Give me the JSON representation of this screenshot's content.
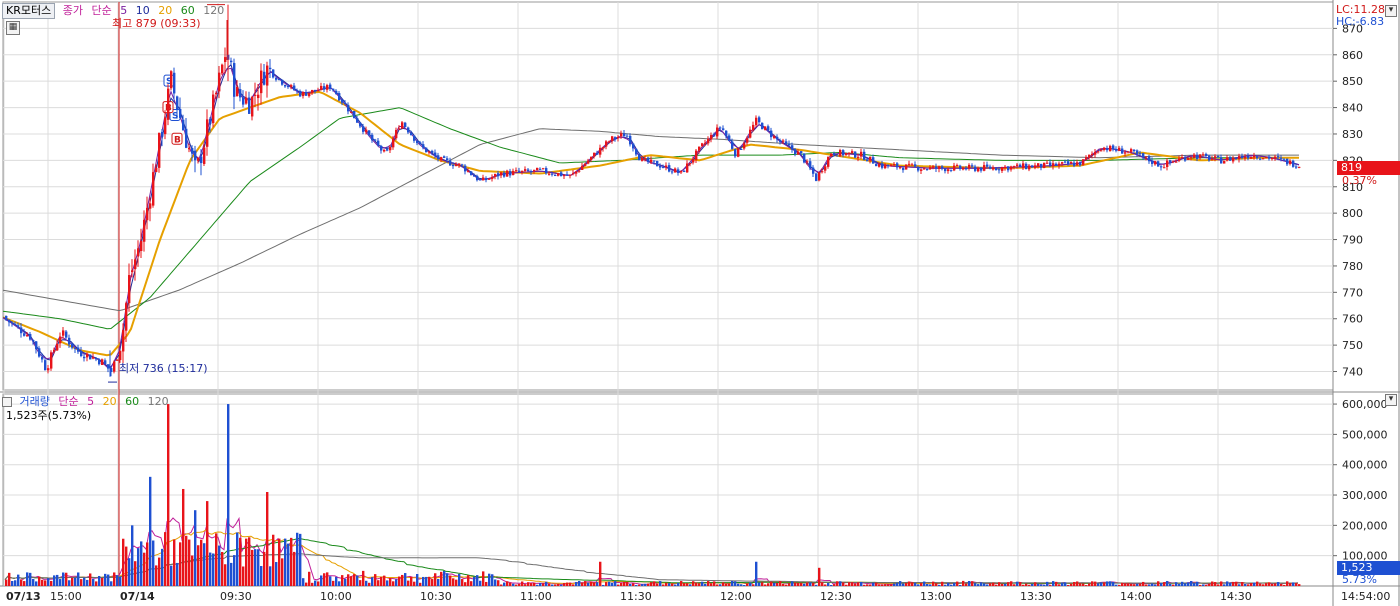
{
  "title": "KR모터스",
  "price_indicator": {
    "name": "종가",
    "method": "단순",
    "periods": [
      "5",
      "10",
      "20",
      "60",
      "120"
    ]
  },
  "volume_indicator": {
    "name": "거래량",
    "method": "단순",
    "periods": [
      "5",
      "20",
      "60",
      "120"
    ]
  },
  "volume_current": "1,523주(5.73%)",
  "annotations": {
    "high": "최고 879 (09:33)",
    "low": "최저 736 (15:17)"
  },
  "right_labels": {
    "lc": "LC:11.28",
    "hc": "HC:-6.83",
    "price_tag": "819",
    "price_pct": "0.37%",
    "vol_tag": "1,523",
    "vol_pct": "5.73%"
  },
  "price_axis": [
    "870",
    "860",
    "850",
    "840",
    "830",
    "820",
    "810",
    "800",
    "790",
    "780",
    "770",
    "760",
    "750",
    "740"
  ],
  "volume_axis": [
    "600,000",
    "500,000",
    "400,000",
    "300,000",
    "200,000",
    "100,000"
  ],
  "time_axis": [
    "07/13",
    "15:00",
    "07/14",
    "09:30",
    "10:00",
    "10:30",
    "11:00",
    "11:30",
    "12:00",
    "12:30",
    "13:00",
    "13:30",
    "14:00",
    "14:30",
    "14:54:00"
  ],
  "colors": {
    "up": "#e8141a",
    "down": "#1e50d2",
    "ma5": "#7a1fa0",
    "ma10": "#1e2c9c",
    "ma20": "#e6a000",
    "ma60": "#1a8a1a",
    "ma120": "#6e6e6e",
    "grid": "#dcdcdc"
  },
  "chart_data": {
    "type": "candlestick",
    "y_range": [
      733,
      880
    ],
    "volume_range": [
      0,
      620000
    ],
    "price_keypoints": [
      [
        0,
        761
      ],
      [
        30,
        753
      ],
      [
        45,
        741
      ],
      [
        60,
        755
      ],
      [
        75,
        748
      ],
      [
        100,
        744
      ],
      [
        110,
        740
      ],
      [
        120,
        750
      ],
      [
        128,
        775
      ],
      [
        140,
        790
      ],
      [
        150,
        810
      ],
      [
        160,
        830
      ],
      [
        170,
        850
      ],
      [
        180,
        835
      ],
      [
        195,
        815
      ],
      [
        205,
        830
      ],
      [
        215,
        845
      ],
      [
        225,
        862
      ],
      [
        235,
        845
      ],
      [
        250,
        842
      ],
      [
        265,
        855
      ],
      [
        280,
        850
      ],
      [
        300,
        845
      ],
      [
        330,
        848
      ],
      [
        350,
        838
      ],
      [
        370,
        828
      ],
      [
        385,
        822
      ],
      [
        400,
        835
      ],
      [
        420,
        825
      ],
      [
        440,
        820
      ],
      [
        460,
        818
      ],
      [
        480,
        812
      ],
      [
        500,
        815
      ],
      [
        540,
        816
      ],
      [
        570,
        814
      ],
      [
        590,
        821
      ],
      [
        610,
        828
      ],
      [
        625,
        830
      ],
      [
        640,
        820
      ],
      [
        660,
        818
      ],
      [
        680,
        815
      ],
      [
        700,
        825
      ],
      [
        720,
        833
      ],
      [
        735,
        822
      ],
      [
        755,
        835
      ],
      [
        775,
        828
      ],
      [
        800,
        822
      ],
      [
        815,
        813
      ],
      [
        830,
        823
      ],
      [
        860,
        822
      ],
      [
        880,
        818
      ],
      [
        930,
        817
      ],
      [
        980,
        817
      ],
      [
        1050,
        818
      ],
      [
        1080,
        819
      ],
      [
        1100,
        825
      ],
      [
        1130,
        823
      ],
      [
        1160,
        818
      ],
      [
        1190,
        822
      ],
      [
        1220,
        820
      ],
      [
        1250,
        822
      ],
      [
        1270,
        821
      ],
      [
        1300,
        818
      ]
    ],
    "ma_keypoints": {
      "ma20": [
        [
          0,
          761
        ],
        [
          40,
          755
        ],
        [
          80,
          748
        ],
        [
          110,
          746
        ],
        [
          130,
          755
        ],
        [
          160,
          790
        ],
        [
          190,
          820
        ],
        [
          220,
          836
        ],
        [
          250,
          840
        ],
        [
          280,
          844
        ],
        [
          320,
          846
        ],
        [
          360,
          838
        ],
        [
          400,
          826
        ],
        [
          440,
          820
        ],
        [
          480,
          816
        ],
        [
          540,
          815
        ],
        [
          600,
          818
        ],
        [
          650,
          822
        ],
        [
          700,
          820
        ],
        [
          750,
          826
        ],
        [
          800,
          824
        ],
        [
          850,
          821
        ],
        [
          900,
          818
        ],
        [
          1000,
          817
        ],
        [
          1080,
          818
        ],
        [
          1140,
          823
        ],
        [
          1200,
          820
        ],
        [
          1260,
          821
        ],
        [
          1300,
          821
        ]
      ],
      "ma60": [
        [
          0,
          763
        ],
        [
          60,
          760
        ],
        [
          110,
          756
        ],
        [
          150,
          768
        ],
        [
          200,
          790
        ],
        [
          250,
          812
        ],
        [
          300,
          825
        ],
        [
          340,
          836
        ],
        [
          400,
          840
        ],
        [
          450,
          832
        ],
        [
          500,
          825
        ],
        [
          560,
          819
        ],
        [
          620,
          820
        ],
        [
          700,
          822
        ],
        [
          780,
          822
        ],
        [
          840,
          823
        ],
        [
          900,
          821
        ],
        [
          1000,
          820
        ],
        [
          1100,
          820
        ],
        [
          1200,
          821
        ],
        [
          1300,
          821
        ]
      ],
      "ma120": [
        [
          0,
          771
        ],
        [
          60,
          767
        ],
        [
          120,
          763
        ],
        [
          180,
          771
        ],
        [
          240,
          781
        ],
        [
          300,
          792
        ],
        [
          360,
          802
        ],
        [
          420,
          814
        ],
        [
          480,
          826
        ],
        [
          540,
          832
        ],
        [
          600,
          831
        ],
        [
          660,
          829
        ],
        [
          720,
          828
        ],
        [
          800,
          826
        ],
        [
          900,
          824
        ],
        [
          1000,
          822
        ],
        [
          1100,
          821
        ],
        [
          1200,
          822
        ],
        [
          1300,
          822
        ]
      ]
    },
    "volume_peaks": [
      [
        168,
        600000
      ],
      [
        228,
        600000
      ],
      [
        265,
        310000
      ],
      [
        150,
        360000
      ],
      [
        183,
        320000
      ],
      [
        205,
        280000
      ],
      [
        195,
        250000
      ],
      [
        130,
        200000
      ],
      [
        125,
        130000
      ],
      [
        600,
        80000
      ],
      [
        755,
        80000
      ],
      [
        817,
        60000
      ]
    ]
  }
}
